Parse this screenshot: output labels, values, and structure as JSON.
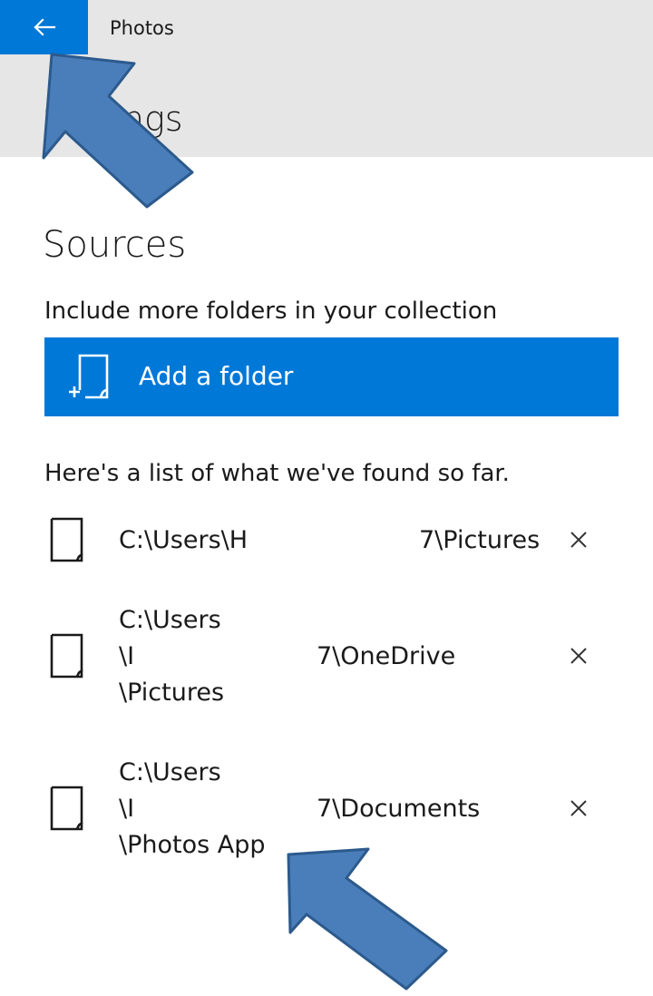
{
  "header": {
    "app_title": "Photos",
    "page_title": "Settings"
  },
  "sources": {
    "title": "Sources",
    "description": "Include more folders in your collection",
    "add_folder_label": "Add a folder",
    "found_description": "Here's a list of what we've found so far."
  },
  "folders": [
    {
      "path_start": "C:\\Users\\H",
      "path_end": "7\\Pictures"
    },
    {
      "path_start": "C:\\Users\n\\I\n\\Pictures",
      "path_end": "7\\OneDrive"
    },
    {
      "path_start": "C:\\Users\n\\I\n\\Photos App",
      "path_end": "7\\Documents"
    }
  ],
  "icons": {
    "back": "arrow-left-icon",
    "add_folder": "folder-add-icon",
    "folder": "folder-icon",
    "remove": "close-icon"
  },
  "colors": {
    "accent": "#0078d7",
    "header_bg": "#e6e6e6",
    "annotation_arrow": "#4a7ebb"
  }
}
